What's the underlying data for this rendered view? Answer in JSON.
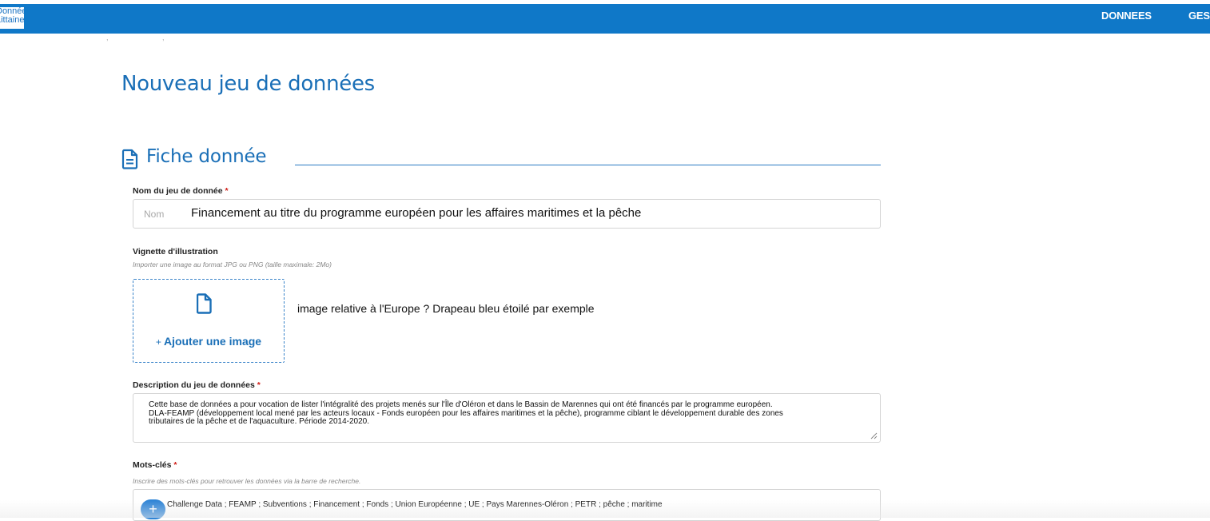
{
  "header": {
    "logo_line1": "Données",
    "logo_line2": "Littaine",
    "nav": [
      "DONNEES",
      "GESTION"
    ]
  },
  "page": {
    "title": "Nouveau jeu de données",
    "section_title": "Fiche donnée"
  },
  "form": {
    "name": {
      "label": "Nom du jeu de donnée",
      "required_mark": "*",
      "placeholder": "Nom",
      "value": "Financement au titre du programme européen pour les affaires maritimes et la pêche"
    },
    "thumbnail": {
      "label": "Vignette d'illustration",
      "hint": "Importer une image au format JPG ou PNG (taille maximale: 2Mo)",
      "button_plus": "+",
      "button_label": "Ajouter une image",
      "note": "image relative à l'Europe ? Drapeau bleu étoilé par exemple"
    },
    "description": {
      "label": "Description du jeu de données",
      "required_mark": "*",
      "value": "Cette base de données a pour vocation de lister l'intégralité des projets menés sur l'Île d'Oléron et dans le Bassin de Marennes qui ont été financés par le programme européen.\nDLA-FEAMP (développement local mené par les acteurs locaux - Fonds européen pour les affaires maritimes et la pêche), programme ciblant le développement durable des zones\n tributaires de la pêche et de l'aquaculture. Période 2014-2020."
    },
    "keywords": {
      "label": "Mots-clés",
      "required_mark": "*",
      "hint": "Inscrire des mots-clés pour retrouver les données via la barre de recherche.",
      "add_symbol": "+",
      "value": "Challenge Data ; FEAMP ; Subventions ; Financement ; Fonds ; Union Européenne ; UE ; Pays Marennes-Oléron ; PETR ; pêche ; maritime"
    }
  },
  "colors": {
    "brand_blue": "#0f78c8",
    "heading_blue": "#1a6fb7",
    "required_red": "#d0201a"
  },
  "icons": {
    "section": "document-icon",
    "upload": "file-icon",
    "add": "plus-icon"
  }
}
